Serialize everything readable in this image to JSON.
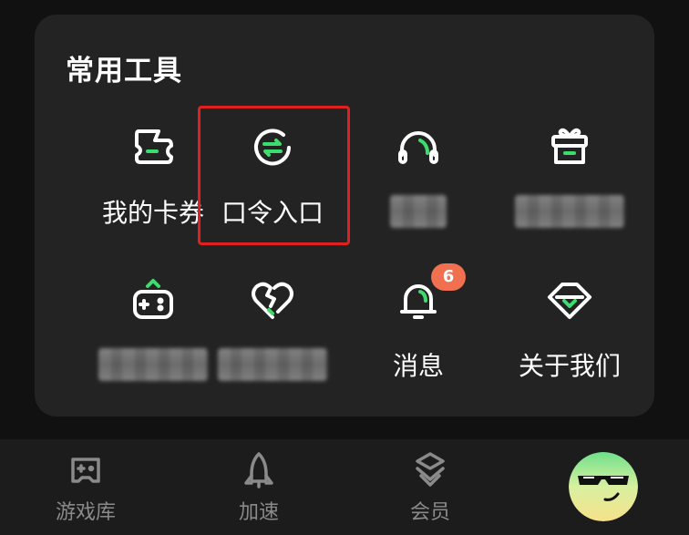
{
  "card": {
    "title": "常用工具",
    "tools": [
      {
        "label": "我的卡券",
        "icon": "coupon-icon"
      },
      {
        "label": "口令入口",
        "icon": "command-exchange-icon"
      },
      {
        "label": "",
        "icon": "headset-icon"
      },
      {
        "label": "",
        "icon": "gift-box-icon"
      },
      {
        "label": "",
        "icon": "gamepad-icon"
      },
      {
        "label": "",
        "icon": "heart-icon"
      },
      {
        "label": "消息",
        "icon": "bell-icon",
        "badge": "6"
      },
      {
        "label": "关于我们",
        "icon": "logo-heart-icon"
      }
    ]
  },
  "tabbar": {
    "tabs": [
      {
        "label": "游戏库",
        "icon": "gamepad-tab-icon"
      },
      {
        "label": "加速",
        "icon": "rocket-tab-icon"
      },
      {
        "label": "会员",
        "icon": "member-tab-icon"
      },
      {
        "label": "",
        "icon": "avatar"
      }
    ]
  },
  "colors": {
    "accent": "#3ddc6e",
    "highlight": "#e02020",
    "badge": "#f07050",
    "card": "#232323",
    "background": "#111111"
  }
}
